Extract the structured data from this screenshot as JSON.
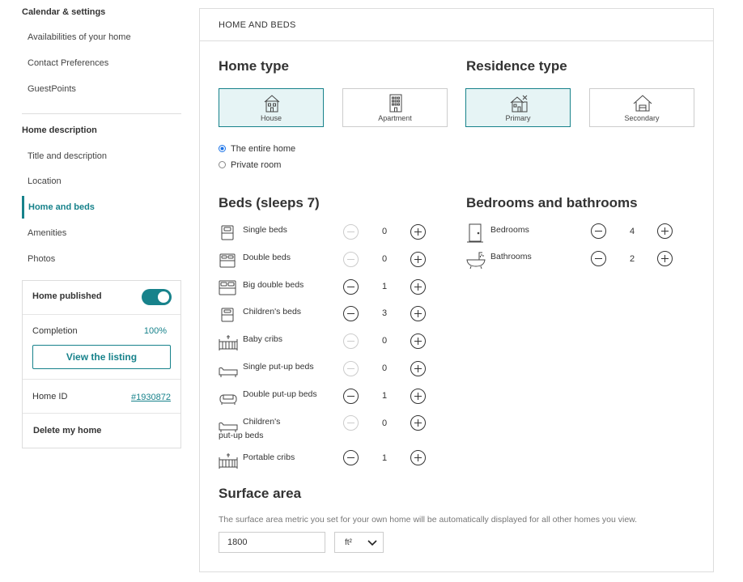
{
  "sidebar": {
    "calendar_heading": "Calendar & settings",
    "calendar_items": [
      "Availabilities of your home",
      "Contact Preferences",
      "GuestPoints"
    ],
    "description_heading": "Home description",
    "description_items": [
      "Title and description",
      "Location",
      "Home and beds",
      "Amenities",
      "Photos"
    ],
    "active_item": "Home and beds"
  },
  "card": {
    "published_label": "Home published",
    "published_on": true,
    "completion_label": "Completion",
    "completion_value": "100%",
    "view_button": "View the listing",
    "home_id_label": "Home ID",
    "home_id_value": "#1930872",
    "delete_label": "Delete my home"
  },
  "panel": {
    "header": "HOME AND BEDS",
    "home_type": {
      "title": "Home type",
      "options": [
        {
          "label": "House",
          "icon": "house-icon",
          "selected": true
        },
        {
          "label": "Apartment",
          "icon": "apartment-icon",
          "selected": false
        }
      ]
    },
    "residence_type": {
      "title": "Residence type",
      "options": [
        {
          "label": "Primary",
          "icon": "primary-residence-icon",
          "selected": true
        },
        {
          "label": "Secondary",
          "icon": "secondary-residence-icon",
          "selected": false
        }
      ]
    },
    "occupancy": {
      "options": [
        {
          "label": "The entire home",
          "checked": true
        },
        {
          "label": "Private room",
          "checked": false
        }
      ]
    },
    "beds": {
      "title": "Beds (sleeps 7)",
      "items": [
        {
          "label": "Single beds",
          "count": "0",
          "icon": "single-bed-icon"
        },
        {
          "label": "Double beds",
          "count": "0",
          "icon": "double-bed-icon"
        },
        {
          "label": "Big double beds",
          "count": "1",
          "icon": "big-double-bed-icon"
        },
        {
          "label": "Children's beds",
          "count": "3",
          "icon": "childrens-bed-icon"
        },
        {
          "label": "Baby cribs",
          "count": "0",
          "icon": "baby-crib-icon"
        },
        {
          "label": "Single put-up beds",
          "count": "0",
          "icon": "single-put-up-bed-icon"
        },
        {
          "label": "Double put-up beds",
          "count": "1",
          "icon": "double-put-up-bed-icon"
        },
        {
          "label": "Children's put-up beds",
          "count": "0",
          "icon": "childrens-put-up-bed-icon"
        },
        {
          "label": "Portable cribs",
          "count": "1",
          "icon": "portable-crib-icon"
        }
      ]
    },
    "rooms": {
      "title": "Bedrooms and bathrooms",
      "items": [
        {
          "label": "Bedrooms",
          "count": "4",
          "icon": "door-icon"
        },
        {
          "label": "Bathrooms",
          "count": "2",
          "icon": "bathtub-icon"
        }
      ]
    },
    "surface": {
      "title": "Surface area",
      "note": "The surface area metric you set for your own home will be automatically displayed for all other homes you view.",
      "value": "1800",
      "unit": "ft²"
    }
  },
  "colors": {
    "accent": "#17828b",
    "selected_bg": "#e6f4f5",
    "radio": "#1a73e8"
  }
}
